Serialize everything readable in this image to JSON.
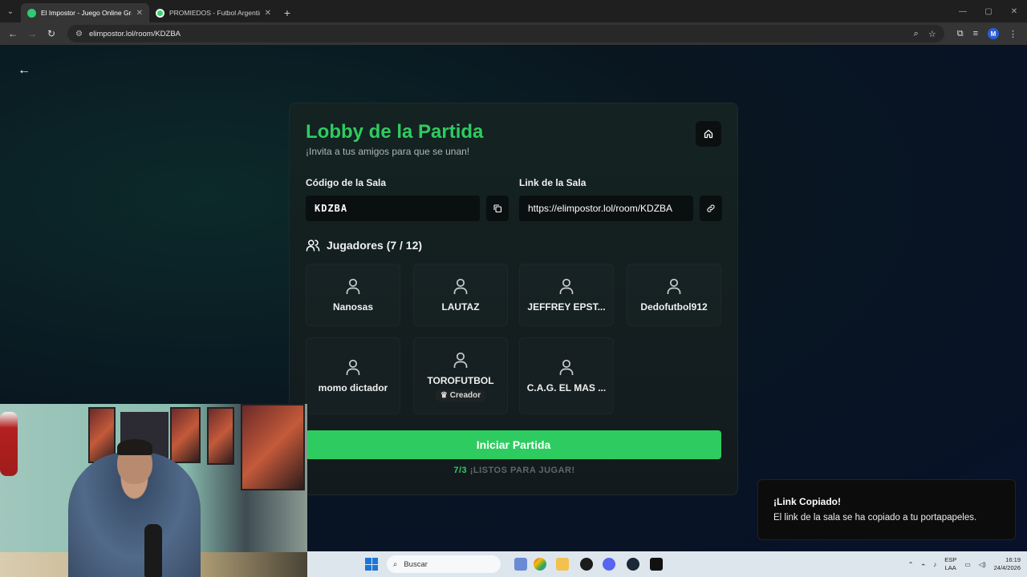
{
  "browser": {
    "tabs": [
      {
        "title": "El Impostor - Juego Online Gratis",
        "active": true
      },
      {
        "title": "PROMIEDOS - Futbol Argentino",
        "active": false
      }
    ],
    "new_tab": "+",
    "url": "elimpostor.lol/room/KDZBA"
  },
  "lobby": {
    "title": "Lobby de la Partida",
    "subtitle": "¡Invita a tus amigos para que se unan!",
    "code_label": "Código de la Sala",
    "code": "KDZBA",
    "link_label": "Link de la Sala",
    "link": "https://elimpostor.lol/room/KDZBA",
    "players_heading": "Jugadores (7 / 12)",
    "players": [
      {
        "name": "Nanosas"
      },
      {
        "name": "LAUTAZ"
      },
      {
        "name": "JEFFREY EPST..."
      },
      {
        "name": "Dedofutbol912"
      },
      {
        "name": "momo dictador"
      },
      {
        "name": "TOROFUTBOL",
        "badge": "Creador"
      },
      {
        "name": "C.A.G. EL MAS ..."
      }
    ],
    "start_button": "Iniciar Partida",
    "ready_count": "7/3",
    "ready_text": "¡LISTOS PARA JUGAR!"
  },
  "toast": {
    "title": "¡Link Copiado!",
    "message": "El link de la sala se ha copiado a tu portapapeles."
  },
  "taskbar": {
    "search_placeholder": "Buscar",
    "lang_top": "ESP",
    "lang_bottom": "LAA",
    "time": "16:19",
    "date": "24/4/2026"
  },
  "colors": {
    "accent_green": "#2ecc60",
    "card_bg": "#142322",
    "toast_bg": "#0c0c0c"
  }
}
